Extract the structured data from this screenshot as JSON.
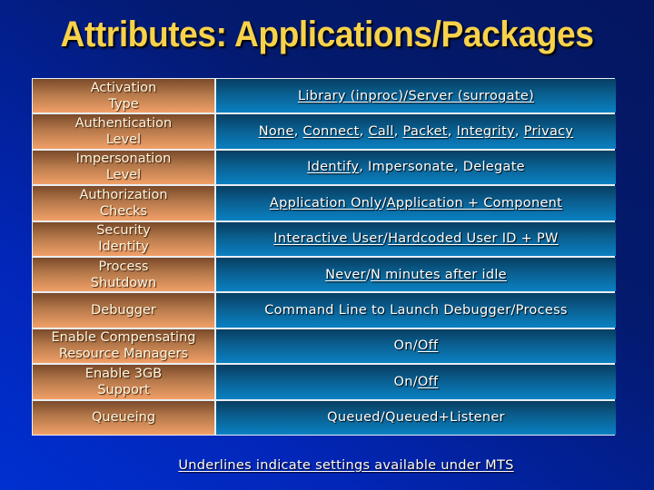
{
  "slide": {
    "title": "Attributes:  Applications/Packages",
    "footer_note": "Underlines indicate settings available under MTS",
    "colors": {
      "title": "#f7d24a",
      "label_cell_top": "#7a4a2a",
      "label_cell_bottom": "#f2a068",
      "value_cell_top": "#073e62",
      "value_cell_bottom": "#0a80c2",
      "background_dark": "#041660",
      "background_light": "#0030d0"
    }
  },
  "rows": [
    {
      "label": "Activation\nType",
      "value": [
        {
          "text": "Library (inproc)/Server (surrogate)",
          "underline": true
        }
      ]
    },
    {
      "label": "Authentication\nLevel",
      "value": [
        {
          "text": "None",
          "underline": true
        },
        {
          "text": ", ",
          "underline": false
        },
        {
          "text": "Connect",
          "underline": true
        },
        {
          "text": ", ",
          "underline": false
        },
        {
          "text": "Call",
          "underline": true
        },
        {
          "text": ", ",
          "underline": false
        },
        {
          "text": "Packet",
          "underline": true
        },
        {
          "text": ", ",
          "underline": false
        },
        {
          "text": "Integrity",
          "underline": true
        },
        {
          "text": ", ",
          "underline": false
        },
        {
          "text": "Privacy",
          "underline": true
        }
      ]
    },
    {
      "label": "Impersonation\nLevel",
      "value": [
        {
          "text": "Identify",
          "underline": true
        },
        {
          "text": ", Impersonate, Delegate",
          "underline": false
        }
      ]
    },
    {
      "label": "Authorization\nChecks",
      "value": [
        {
          "text": "Application Only",
          "underline": true
        },
        {
          "text": "/",
          "underline": false
        },
        {
          "text": "Application + Component",
          "underline": true
        }
      ]
    },
    {
      "label": "Security\nIdentity",
      "value": [
        {
          "text": "Interactive User",
          "underline": true
        },
        {
          "text": "/",
          "underline": false
        },
        {
          "text": "Hardcoded User ID + PW",
          "underline": true
        }
      ]
    },
    {
      "label": "Process\nShutdown",
      "value": [
        {
          "text": "Never",
          "underline": true
        },
        {
          "text": "/",
          "underline": false
        },
        {
          "text": "N minutes after idle",
          "underline": true
        }
      ]
    },
    {
      "label": "Debugger",
      "value": [
        {
          "text": "Command Line to Launch Debugger/Process",
          "underline": false
        }
      ]
    },
    {
      "label": "Enable Compensating\nResource Managers",
      "value": [
        {
          "text": "On/",
          "underline": false
        },
        {
          "text": "Off",
          "underline": true
        }
      ]
    },
    {
      "label": "Enable 3GB\nSupport",
      "value": [
        {
          "text": "On/",
          "underline": false
        },
        {
          "text": "Off",
          "underline": true
        }
      ]
    },
    {
      "label": "Queueing",
      "value": [
        {
          "text": "Queued/Queued+Listener",
          "underline": false
        }
      ]
    }
  ]
}
